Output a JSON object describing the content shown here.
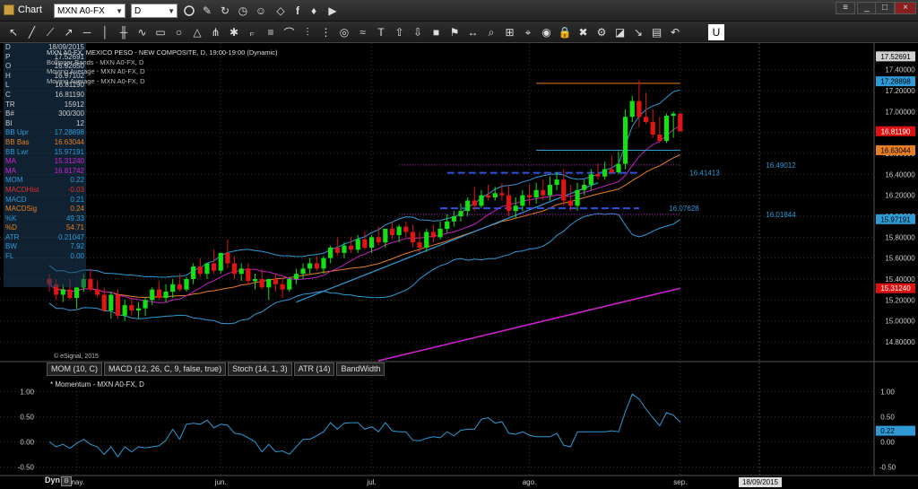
{
  "window": {
    "title": "Chart",
    "symbol": "MXN A0-FX",
    "interval": "D"
  },
  "legend": {
    "title": "MXN A0-FX, MEXICO PESO - NEW COMPOSITE, D, 19:00-19:00 (Dynamic)",
    "lines": [
      "Bollinger Bands - MXN A0-FX, D",
      "Moving Average - MXN A0-FX, D",
      "Moving Average - MXN A0-FX, D"
    ]
  },
  "data_window": [
    {
      "k": "D",
      "v": "18/09/2015",
      "c": "#cccccc"
    },
    {
      "k": "P",
      "v": "17.52691",
      "c": "#cccccc"
    },
    {
      "k": "O",
      "v": "16.92650",
      "c": "#cccccc"
    },
    {
      "k": "H",
      "v": "16.97102",
      "c": "#cccccc"
    },
    {
      "k": "L",
      "v": "16.81190",
      "c": "#cccccc"
    },
    {
      "k": "C",
      "v": "16.81190",
      "c": "#cccccc"
    },
    {
      "k": "TR",
      "v": "15912",
      "c": "#cccccc"
    },
    {
      "k": "B#",
      "v": "300/300",
      "c": "#cccccc"
    },
    {
      "k": "BI",
      "v": "12",
      "c": "#cccccc"
    },
    {
      "k": "BB Upr",
      "v": "17.28898",
      "c": "#2e9bd6"
    },
    {
      "k": "BB Bas",
      "v": "16.63044",
      "c": "#e67e22"
    },
    {
      "k": "BB Lwr",
      "v": "15.97191",
      "c": "#2e9bd6"
    },
    {
      "k": "MA",
      "v": "15.31240",
      "c": "#d020d0"
    },
    {
      "k": "MA",
      "v": "16.81742",
      "c": "#d020d0"
    },
    {
      "k": "MOM",
      "v": "0.22",
      "c": "#2e9bd6"
    },
    {
      "k": "MACDHist",
      "v": "-0.03",
      "c": "#e03030"
    },
    {
      "k": "MACD",
      "v": "0.21",
      "c": "#2e9bd6"
    },
    {
      "k": "MACDSig",
      "v": "0.24",
      "c": "#e67e22"
    },
    {
      "k": "%K",
      "v": "49.33",
      "c": "#2e9bd6"
    },
    {
      "k": "%D",
      "v": "54.71",
      "c": "#e67e22"
    },
    {
      "k": "ATR",
      "v": "0.21047",
      "c": "#2e9bd6"
    },
    {
      "k": "BW",
      "v": "7.92",
      "c": "#2e9bd6"
    },
    {
      "k": "FL",
      "v": "0.00",
      "c": "#2e9bd6"
    }
  ],
  "price_labels": [
    {
      "v": "17.52691",
      "bg": "#d0d0d0",
      "fg": "#000000"
    },
    {
      "v": "17.28898",
      "bg": "#2e9bd6",
      "fg": "#000000"
    },
    {
      "v": "16.81190",
      "bg": "#e01010",
      "fg": "#ffffff"
    },
    {
      "v": "16.63044",
      "bg": "#e67e22",
      "fg": "#000000"
    },
    {
      "v": "15.97191",
      "bg": "#2e9bd6",
      "fg": "#000000"
    },
    {
      "v": "15.31240",
      "bg": "#e01010",
      "fg": "#ffffff"
    }
  ],
  "annotations": [
    "16.49012",
    "16.41413",
    "16.07628",
    "16.01844"
  ],
  "copyright": "© eSignal, 2015",
  "study_tabs": [
    "MOM (10, C)",
    "MACD (12, 26, C, 9, false, true)",
    "Stoch (14, 1, 3)",
    "ATR (14)",
    "BandWidth"
  ],
  "momentum_label": "* Momentum - MXN A0-FX, D",
  "momentum_value": "0.22",
  "momentum_ticks": [
    "1.00",
    "0.50",
    "0.00",
    "-0.50"
  ],
  "x_axis": {
    "months": [
      "may.",
      "jun.",
      "jul.",
      "ago.",
      "sep."
    ],
    "dyn": "Dyn",
    "date_label": "18/09/2015"
  },
  "chart_data": {
    "type": "candlestick",
    "title": "MXN A0-FX, MEXICO PESO - NEW COMPOSITE, D, 19:00-19:00 (Dynamic)",
    "ylim": [
      14.62,
      17.62
    ],
    "y_ticks": [
      14.8,
      15.0,
      15.2,
      15.4,
      15.6,
      15.8,
      16.0,
      16.2,
      16.4,
      16.6,
      16.8,
      17.0,
      17.2,
      17.4
    ],
    "grid": true,
    "x_dates": [
      "2015-04-27",
      "2015-04-28",
      "2015-04-29",
      "2015-04-30",
      "2015-05-01",
      "2015-05-04",
      "2015-05-05",
      "2015-05-06",
      "2015-05-07",
      "2015-05-08",
      "2015-05-11",
      "2015-05-12",
      "2015-05-13",
      "2015-05-14",
      "2015-05-15",
      "2015-05-18",
      "2015-05-19",
      "2015-05-20",
      "2015-05-21",
      "2015-05-22",
      "2015-05-25",
      "2015-05-26",
      "2015-05-27",
      "2015-05-28",
      "2015-05-29",
      "2015-06-01",
      "2015-06-02",
      "2015-06-03",
      "2015-06-04",
      "2015-06-05",
      "2015-06-08",
      "2015-06-09",
      "2015-06-10",
      "2015-06-11",
      "2015-06-12",
      "2015-06-15",
      "2015-06-16",
      "2015-06-17",
      "2015-06-18",
      "2015-06-19",
      "2015-06-22",
      "2015-06-23",
      "2015-06-24",
      "2015-06-25",
      "2015-06-26",
      "2015-06-29",
      "2015-06-30",
      "2015-07-01",
      "2015-07-02",
      "2015-07-03",
      "2015-07-06",
      "2015-07-07",
      "2015-07-08",
      "2015-07-09",
      "2015-07-10",
      "2015-07-13",
      "2015-07-14",
      "2015-07-15",
      "2015-07-16",
      "2015-07-17",
      "2015-07-20",
      "2015-07-21",
      "2015-07-22",
      "2015-07-23",
      "2015-07-24",
      "2015-07-27",
      "2015-07-28",
      "2015-07-29",
      "2015-07-30",
      "2015-07-31",
      "2015-08-03",
      "2015-08-04",
      "2015-08-05",
      "2015-08-06",
      "2015-08-07",
      "2015-08-10",
      "2015-08-11",
      "2015-08-12",
      "2015-08-13",
      "2015-08-14",
      "2015-08-17",
      "2015-08-18",
      "2015-08-19",
      "2015-08-20",
      "2015-08-21",
      "2015-08-24",
      "2015-08-25",
      "2015-08-26",
      "2015-08-27",
      "2015-08-28",
      "2015-08-31",
      "2015-09-01",
      "2015-09-02"
    ],
    "open": [
      15.4,
      15.35,
      15.25,
      15.3,
      15.22,
      15.32,
      15.4,
      15.3,
      15.25,
      15.1,
      15.25,
      15.05,
      15.15,
      15.1,
      15.12,
      15.2,
      15.3,
      15.22,
      15.28,
      15.35,
      15.3,
      15.4,
      15.52,
      15.45,
      15.55,
      15.48,
      15.65,
      15.55,
      15.45,
      15.5,
      15.38,
      15.4,
      15.32,
      15.4,
      15.35,
      15.3,
      15.4,
      15.45,
      15.5,
      15.55,
      15.5,
      15.6,
      15.7,
      15.65,
      15.72,
      15.68,
      15.78,
      15.7,
      15.8,
      15.75,
      15.88,
      15.82,
      15.9,
      15.85,
      15.75,
      15.7,
      15.85,
      15.8,
      15.88,
      15.95,
      16.0,
      16.05,
      16.15,
      16.1,
      16.2,
      16.18,
      16.22,
      16.2,
      16.05,
      16.1,
      16.2,
      16.18,
      16.25,
      16.2,
      16.3,
      16.35,
      16.15,
      16.1,
      16.25,
      16.3,
      16.4,
      16.38,
      16.45,
      16.42,
      16.5,
      16.95,
      17.1,
      16.95,
      16.9,
      16.78,
      16.72,
      16.96,
      16.98
    ],
    "high": [
      15.45,
      15.4,
      15.35,
      15.4,
      15.32,
      15.45,
      15.5,
      15.38,
      15.32,
      15.28,
      15.3,
      15.2,
      15.22,
      15.18,
      15.22,
      15.32,
      15.38,
      15.35,
      15.4,
      15.45,
      15.42,
      15.55,
      15.6,
      15.55,
      15.68,
      15.6,
      15.78,
      15.62,
      15.55,
      15.55,
      15.45,
      15.5,
      15.4,
      15.45,
      15.4,
      15.42,
      15.5,
      15.55,
      15.6,
      15.62,
      15.62,
      15.72,
      15.8,
      15.75,
      15.8,
      15.82,
      15.85,
      15.82,
      15.9,
      15.85,
      15.95,
      15.92,
      15.95,
      15.92,
      15.85,
      15.88,
      15.92,
      15.95,
      16.02,
      16.05,
      16.12,
      16.18,
      16.28,
      16.25,
      16.3,
      16.28,
      16.32,
      16.3,
      16.18,
      16.25,
      16.3,
      16.32,
      16.35,
      16.38,
      16.42,
      16.45,
      16.3,
      16.32,
      16.35,
      16.45,
      16.5,
      16.52,
      16.58,
      16.62,
      17.02,
      17.15,
      17.3,
      17.18,
      17.02,
      16.95,
      16.98,
      17.0,
      16.99
    ],
    "low": [
      15.28,
      15.2,
      15.18,
      15.2,
      15.12,
      15.28,
      15.28,
      15.22,
      15.08,
      15.02,
      15.02,
      15.0,
      15.05,
      15.02,
      15.05,
      15.15,
      15.2,
      15.18,
      15.22,
      15.28,
      15.28,
      15.35,
      15.42,
      15.4,
      15.45,
      15.45,
      15.5,
      15.4,
      15.38,
      15.35,
      15.3,
      15.3,
      15.2,
      15.28,
      15.22,
      15.28,
      15.35,
      15.4,
      15.45,
      15.48,
      15.45,
      15.55,
      15.62,
      15.6,
      15.65,
      15.65,
      15.68,
      15.65,
      15.72,
      15.7,
      15.78,
      15.75,
      15.8,
      15.7,
      15.65,
      15.66,
      15.75,
      15.78,
      15.84,
      15.9,
      15.95,
      16.0,
      16.05,
      16.08,
      16.15,
      16.15,
      16.15,
      16.0,
      15.98,
      16.05,
      16.1,
      16.12,
      16.15,
      16.15,
      16.25,
      16.1,
      16.05,
      16.05,
      16.2,
      16.25,
      16.35,
      16.35,
      16.4,
      16.4,
      16.45,
      16.9,
      16.85,
      16.88,
      16.75,
      16.7,
      16.7,
      16.75,
      16.81
    ],
    "close": [
      15.35,
      15.25,
      15.3,
      15.22,
      15.32,
      15.4,
      15.3,
      15.25,
      15.1,
      15.25,
      15.05,
      15.15,
      15.1,
      15.12,
      15.2,
      15.3,
      15.22,
      15.28,
      15.35,
      15.3,
      15.4,
      15.52,
      15.45,
      15.55,
      15.48,
      15.65,
      15.55,
      15.45,
      15.5,
      15.38,
      15.4,
      15.32,
      15.4,
      15.35,
      15.3,
      15.4,
      15.45,
      15.5,
      15.55,
      15.5,
      15.6,
      15.7,
      15.65,
      15.72,
      15.68,
      15.78,
      15.7,
      15.8,
      15.75,
      15.88,
      15.82,
      15.9,
      15.85,
      15.75,
      15.7,
      15.85,
      15.8,
      15.88,
      15.95,
      16.0,
      16.05,
      16.15,
      16.1,
      16.2,
      16.18,
      16.22,
      16.2,
      16.05,
      16.1,
      16.2,
      16.18,
      16.25,
      16.2,
      16.3,
      16.35,
      16.15,
      16.1,
      16.25,
      16.3,
      16.4,
      16.38,
      16.45,
      16.42,
      16.5,
      16.95,
      17.1,
      16.95,
      16.9,
      16.78,
      16.72,
      16.96,
      16.98,
      16.81
    ],
    "horizontal_lines": [
      {
        "value": 17.27,
        "color": "#e67e22",
        "style": "solid",
        "from_index": 71,
        "to_index": 92
      },
      {
        "value": 16.63,
        "color": "#2e9bd6",
        "style": "solid",
        "from_index": 71,
        "to_index": 92
      },
      {
        "value": 16.49012,
        "color": "#d020d0",
        "style": "dotted",
        "from_index": 51,
        "to_index": 92
      },
      {
        "value": 16.41413,
        "color": "#3050e0",
        "style": "dashed",
        "from_index": 58,
        "to_index": 86
      },
      {
        "value": 16.07628,
        "color": "#3050e0",
        "style": "dashed",
        "from_index": 57,
        "to_index": 86
      },
      {
        "value": 16.01844,
        "color": "#d020d0",
        "style": "dotted",
        "from_index": 51,
        "to_index": 92
      }
    ],
    "trendline": {
      "from_index": 36,
      "from_value": 15.18,
      "to_index": 80,
      "to_value": 16.32,
      "color": "#2e9bd6"
    },
    "bollinger_upper": {
      "at_index": 92,
      "value": 17.28898
    },
    "bollinger_basis": {
      "at_index": 92,
      "value": 16.63044
    },
    "bollinger_lower": {
      "at_index": 92,
      "value": 15.97191
    },
    "long_ma": {
      "at_index": 92,
      "value": 15.3124
    },
    "momentum": {
      "ylim": [
        -0.6,
        1.15
      ],
      "ticks": [
        1.0,
        0.5,
        0.0,
        -0.5
      ],
      "last": 0.22
    }
  }
}
